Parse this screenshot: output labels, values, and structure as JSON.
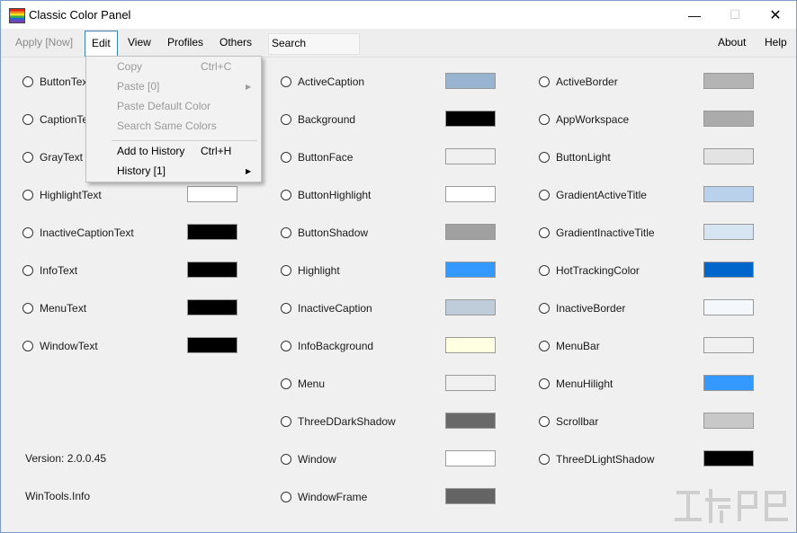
{
  "window": {
    "title": "Classic Color Panel",
    "minimize": "—",
    "maximize": "☐",
    "close": "✕"
  },
  "menubar": {
    "apply": "Apply [Now]",
    "edit": "Edit",
    "view": "View",
    "profiles": "Profiles",
    "others": "Others",
    "search_placeholder": "Search",
    "about": "About",
    "help": "Help"
  },
  "edit_menu": {
    "copy": "Copy",
    "copy_shortcut": "Ctrl+C",
    "paste": "Paste [0]",
    "paste_default": "Paste Default Color",
    "search_same": "Search Same Colors",
    "add_history": "Add to History",
    "add_history_shortcut": "Ctrl+H",
    "history": "History [1]",
    "arrow": "▶"
  },
  "colors_col1": [
    {
      "label": "ButtonText",
      "color": "#000000"
    },
    {
      "label": "CaptionText",
      "color": "#000000"
    },
    {
      "label": "GrayText",
      "color": "#6d6d6d"
    },
    {
      "label": "HighlightText",
      "color": "#ffffff"
    },
    {
      "label": "InactiveCaptionText",
      "color": "#000000"
    },
    {
      "label": "InfoText",
      "color": "#000000"
    },
    {
      "label": "MenuText",
      "color": "#000000"
    },
    {
      "label": "WindowText",
      "color": "#000000"
    }
  ],
  "colors_col2": [
    {
      "label": "ActiveCaption",
      "color": "#99b4d1"
    },
    {
      "label": "Background",
      "color": "#000000"
    },
    {
      "label": "ButtonFace",
      "color": "#f0f0f0"
    },
    {
      "label": "ButtonHighlight",
      "color": "#ffffff"
    },
    {
      "label": "ButtonShadow",
      "color": "#a0a0a0"
    },
    {
      "label": "Highlight",
      "color": "#3399ff"
    },
    {
      "label": "InactiveCaption",
      "color": "#bfcddb"
    },
    {
      "label": "InfoBackground",
      "color": "#ffffe1"
    },
    {
      "label": "Menu",
      "color": "#f0f0f0"
    },
    {
      "label": "ThreeDDarkShadow",
      "color": "#696969"
    },
    {
      "label": "Window",
      "color": "#ffffff"
    },
    {
      "label": "WindowFrame",
      "color": "#646464"
    }
  ],
  "colors_col3": [
    {
      "label": "ActiveBorder",
      "color": "#b4b4b4"
    },
    {
      "label": "AppWorkspace",
      "color": "#ababab"
    },
    {
      "label": "ButtonLight",
      "color": "#e3e3e3"
    },
    {
      "label": "GradientActiveTitle",
      "color": "#b9d1ea"
    },
    {
      "label": "GradientInactiveTitle",
      "color": "#d7e4f2"
    },
    {
      "label": "HotTrackingColor",
      "color": "#0066cc"
    },
    {
      "label": "InactiveBorder",
      "color": "#f4f7fc"
    },
    {
      "label": "MenuBar",
      "color": "#f0f0f0"
    },
    {
      "label": "MenuHilight",
      "color": "#3399ff"
    },
    {
      "label": "Scrollbar",
      "color": "#c8c8c8"
    },
    {
      "label": "ThreeDLightShadow",
      "color": "#000000"
    }
  ],
  "footer": {
    "version": "Version: 2.0.0.45",
    "site": "WinTools.Info"
  }
}
